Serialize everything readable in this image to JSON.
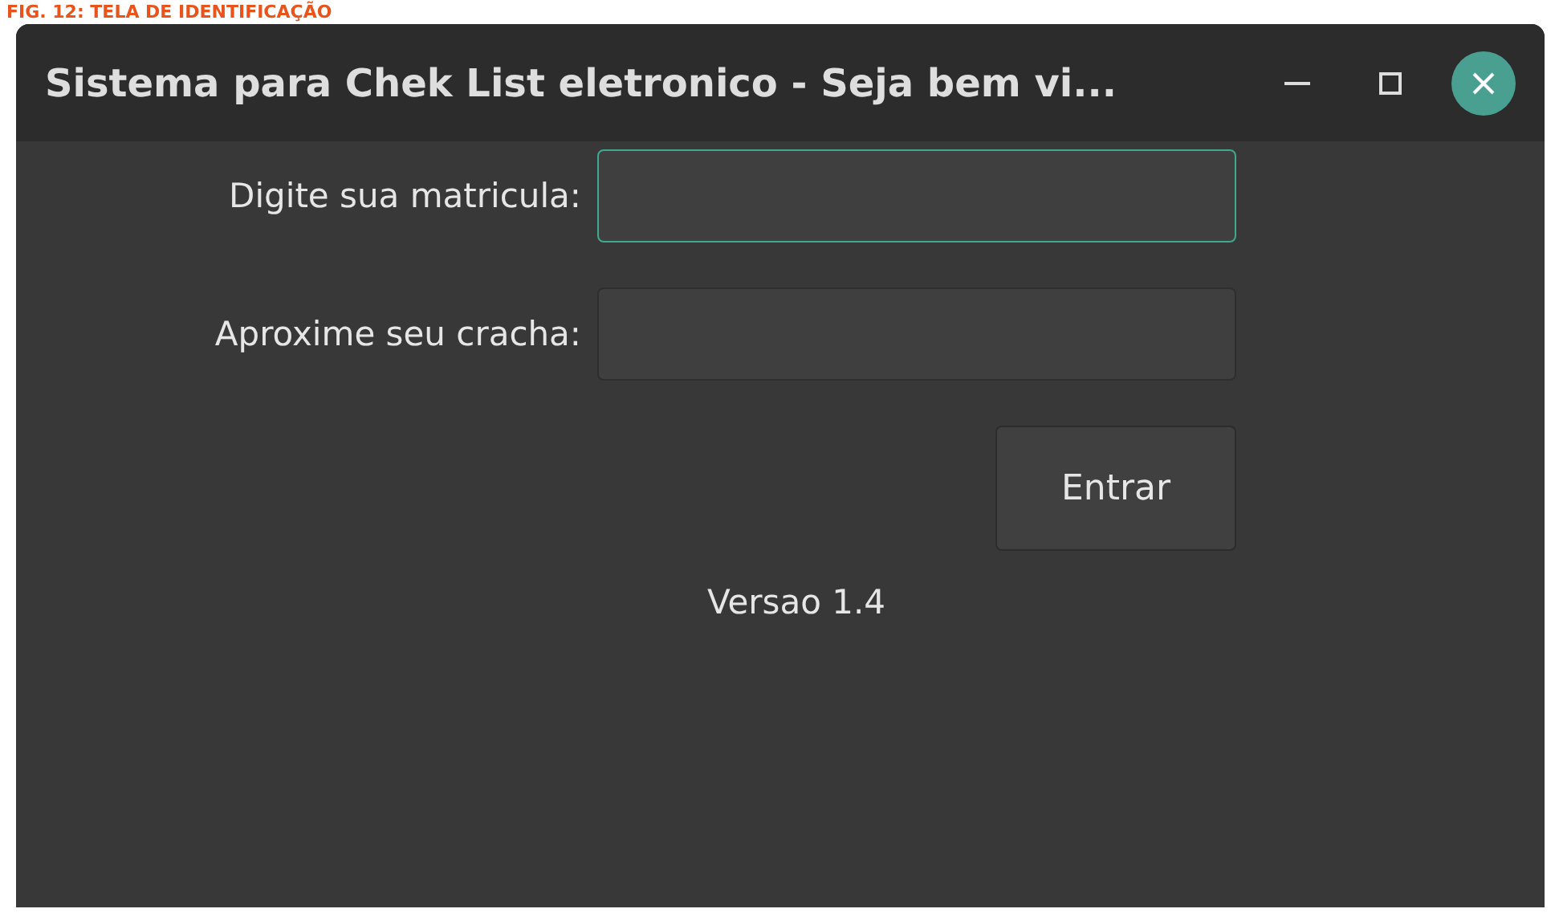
{
  "caption": "FIG. 12: TELA DE IDENTIFICAÇÃO",
  "window": {
    "title": "Sistema para Chek List eletronico - Seja bem vi..."
  },
  "fields": [
    {
      "label": "Digite sua matricula:",
      "focused": true
    },
    {
      "label": "Aproxime seu cracha:",
      "focused": false
    }
  ],
  "submit_button": "Entrar",
  "version": "Versao 1.4"
}
